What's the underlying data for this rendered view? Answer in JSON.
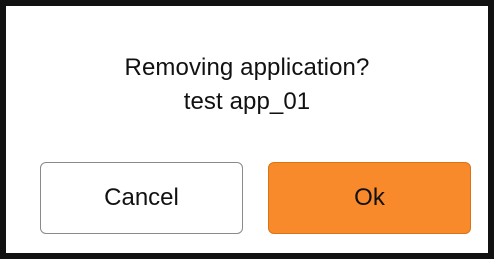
{
  "dialog": {
    "message_line1": "Removing application?",
    "message_line2": "test app_01",
    "cancel_label": "Cancel",
    "ok_label": "Ok"
  },
  "colors": {
    "border": "#111111",
    "background": "#ffffff",
    "ok_button": "#f98a2b",
    "cancel_button": "#ffffff",
    "text": "#111111"
  }
}
